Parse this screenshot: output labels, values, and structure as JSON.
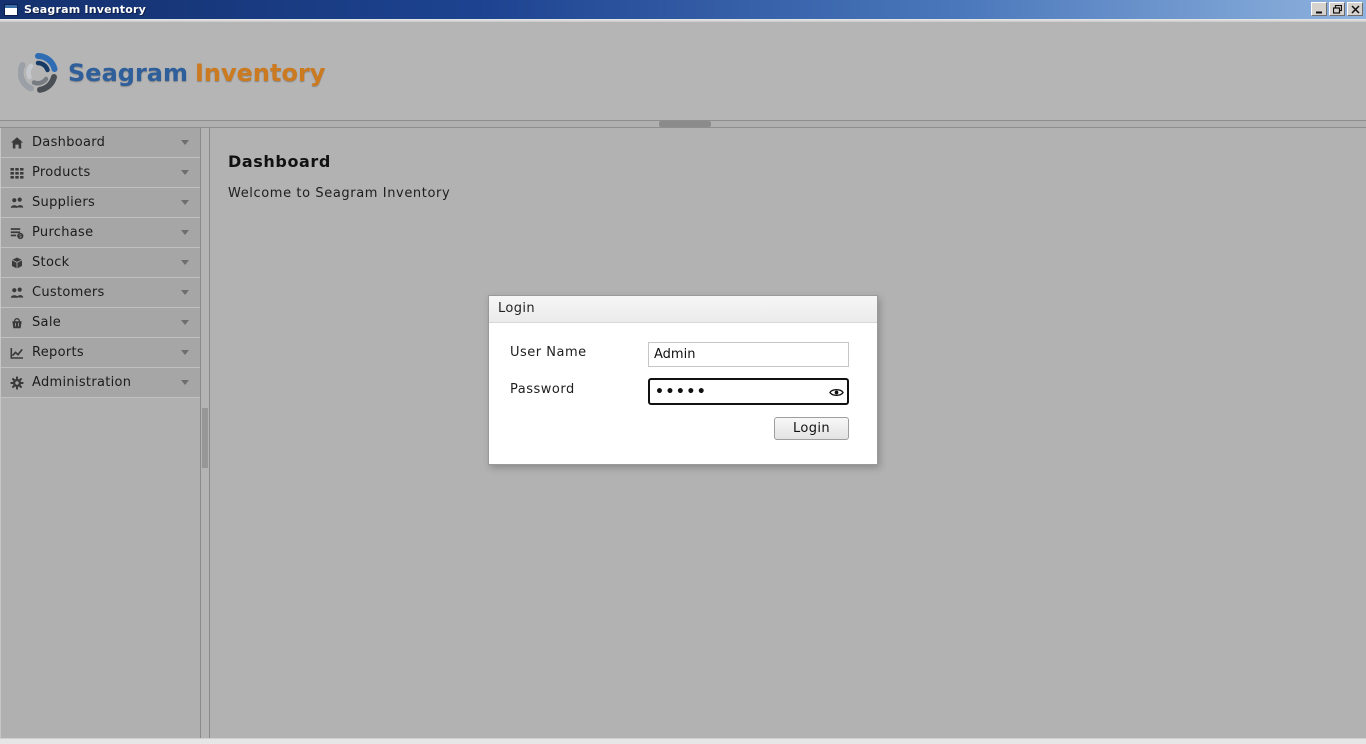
{
  "window": {
    "title": "Seagram Inventory",
    "controls": [
      {
        "name": "minimize",
        "icon": "minimize-icon"
      },
      {
        "name": "restore",
        "icon": "restore-icon"
      },
      {
        "name": "close",
        "icon": "close-icon"
      }
    ]
  },
  "logo": {
    "icon": "swirl-logo-icon",
    "brand_primary": "Seagram",
    "brand_secondary": "Inventory"
  },
  "sidebar": {
    "items": [
      {
        "label": "Dashboard",
        "icon": "home-icon"
      },
      {
        "label": "Products",
        "icon": "grid-icon"
      },
      {
        "label": "Suppliers",
        "icon": "people-icon"
      },
      {
        "label": "Purchase",
        "icon": "purchase-list-icon"
      },
      {
        "label": "Stock",
        "icon": "box-icon"
      },
      {
        "label": "Customers",
        "icon": "people-icon"
      },
      {
        "label": "Sale",
        "icon": "basket-icon"
      },
      {
        "label": "Reports",
        "icon": "chart-icon"
      },
      {
        "label": "Administration",
        "icon": "gear-icon"
      }
    ]
  },
  "main": {
    "heading": "Dashboard",
    "welcome_text": "Welcome to Seagram Inventory"
  },
  "login_dialog": {
    "title": "Login",
    "username_label": "User Name",
    "username_value": "Admin",
    "password_label": "Password",
    "password_value": "•••••",
    "password_masked_count": 5,
    "login_button_label": "Login",
    "eye_icon": "eye-icon"
  },
  "colors": {
    "titlebar_gradient_start": "#14306e",
    "titlebar_gradient_end": "#8fb3de",
    "window_background": "#b3b3b3",
    "sidebar_row_background": "#a6a6a6",
    "brand_blue": "#2e5f9b",
    "brand_orange": "#cc7a1f",
    "dialog_background": "#ffffff"
  }
}
